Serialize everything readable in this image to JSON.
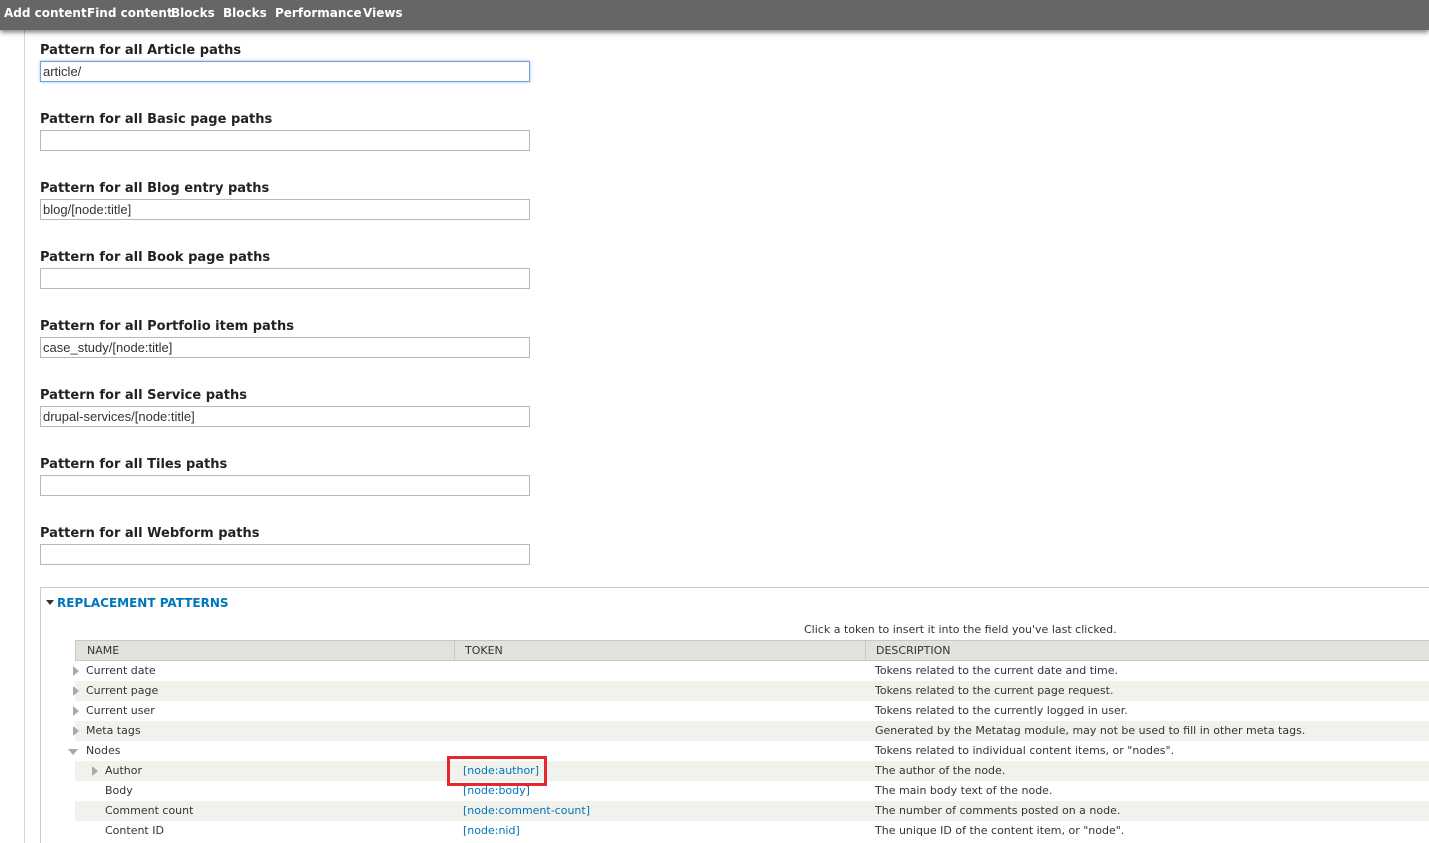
{
  "toolbar": {
    "items": [
      "Add content",
      "Find content",
      "Blocks",
      "Blocks",
      "Performance",
      "Views"
    ]
  },
  "patterns": [
    {
      "label": "Pattern for all Article paths",
      "value": "article/"
    },
    {
      "label": "Pattern for all Basic page paths",
      "value": ""
    },
    {
      "label": "Pattern for all Blog entry paths",
      "value": "blog/[node:title]"
    },
    {
      "label": "Pattern for all Book page paths",
      "value": ""
    },
    {
      "label": "Pattern for all Portfolio item paths",
      "value": "case_study/[node:title]"
    },
    {
      "label": "Pattern for all Service paths",
      "value": "drupal-services/[node:title]"
    },
    {
      "label": "Pattern for all Tiles paths",
      "value": ""
    },
    {
      "label": "Pattern for all Webform paths",
      "value": ""
    }
  ],
  "replacement": {
    "legend": "REPLACEMENT PATTERNS",
    "help": "Click a token to insert it into the field you've last clicked.",
    "headers": [
      "NAME",
      "TOKEN",
      "DESCRIPTION"
    ],
    "rows": [
      {
        "name": "Current date",
        "token": "",
        "description": "Tokens related to the current date and time."
      },
      {
        "name": "Current page",
        "token": "",
        "description": "Tokens related to the current page request."
      },
      {
        "name": "Current user",
        "token": "",
        "description": "Tokens related to the currently logged in user."
      },
      {
        "name": "Meta tags",
        "token": "",
        "description": "Generated by the Metatag module, may not be used to fill in other meta tags."
      },
      {
        "name": "Nodes",
        "token": "",
        "description": "Tokens related to individual content items, or \"nodes\"."
      },
      {
        "name": "Author",
        "token": "[node:author]",
        "description": "The author of the node."
      },
      {
        "name": "Body",
        "token": "[node:body]",
        "description": "The main body text of the node."
      },
      {
        "name": "Comment count",
        "token": "[node:comment-count]",
        "description": "The number of comments posted on a node."
      },
      {
        "name": "Content ID",
        "token": "[node:nid]",
        "description": "The unique ID of the content item, or \"node\"."
      }
    ]
  },
  "colors": {
    "toolbar_bg": "#666666",
    "link": "#0074bd",
    "highlight": "#e8262d"
  }
}
